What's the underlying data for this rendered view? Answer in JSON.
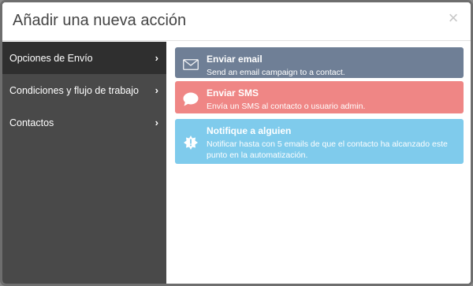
{
  "modal": {
    "title": "Añadir una nueva acción",
    "close_glyph": "×"
  },
  "sidebar": {
    "items": [
      {
        "label": "Opciones de Envío",
        "active": true
      },
      {
        "label": "Condiciones y flujo de trabajo",
        "active": false
      },
      {
        "label": "Contactos",
        "active": false
      }
    ],
    "chevron": "›"
  },
  "actions": [
    {
      "title": "Enviar email",
      "description": "Send an email campaign to a contact.",
      "icon": "envelope-icon",
      "color": "#6f7f96"
    },
    {
      "title": "Enviar SMS",
      "description": "Envía un SMS al contacto o usuario admin.",
      "icon": "speech-bubble-icon",
      "color": "#ef8685"
    },
    {
      "title": "Notifique a alguien",
      "description": "Notificar hasta con 5 emails de que el contacto ha alcanzado este punto en la automatización.",
      "icon": "alert-burst-icon",
      "color": "#7fcbec"
    }
  ],
  "colors": {
    "sidebar_bg": "#494949",
    "sidebar_active_bg": "#2f2f2f"
  }
}
